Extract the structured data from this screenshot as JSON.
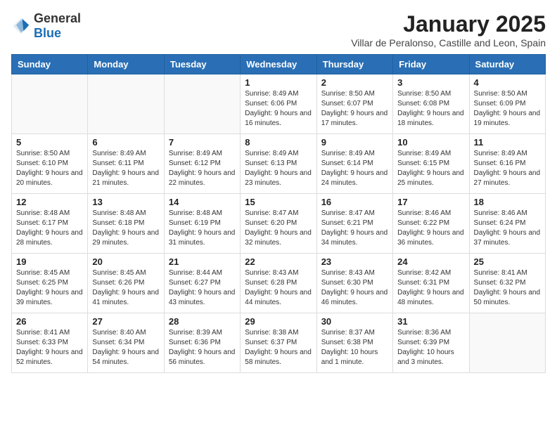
{
  "header": {
    "logo_general": "General",
    "logo_blue": "Blue",
    "month_year": "January 2025",
    "location": "Villar de Peralonso, Castille and Leon, Spain"
  },
  "days_of_week": [
    "Sunday",
    "Monday",
    "Tuesday",
    "Wednesday",
    "Thursday",
    "Friday",
    "Saturday"
  ],
  "weeks": [
    [
      {
        "day": "",
        "info": ""
      },
      {
        "day": "",
        "info": ""
      },
      {
        "day": "",
        "info": ""
      },
      {
        "day": "1",
        "info": "Sunrise: 8:49 AM\nSunset: 6:06 PM\nDaylight: 9 hours and 16 minutes."
      },
      {
        "day": "2",
        "info": "Sunrise: 8:50 AM\nSunset: 6:07 PM\nDaylight: 9 hours and 17 minutes."
      },
      {
        "day": "3",
        "info": "Sunrise: 8:50 AM\nSunset: 6:08 PM\nDaylight: 9 hours and 18 minutes."
      },
      {
        "day": "4",
        "info": "Sunrise: 8:50 AM\nSunset: 6:09 PM\nDaylight: 9 hours and 19 minutes."
      }
    ],
    [
      {
        "day": "5",
        "info": "Sunrise: 8:50 AM\nSunset: 6:10 PM\nDaylight: 9 hours and 20 minutes."
      },
      {
        "day": "6",
        "info": "Sunrise: 8:49 AM\nSunset: 6:11 PM\nDaylight: 9 hours and 21 minutes."
      },
      {
        "day": "7",
        "info": "Sunrise: 8:49 AM\nSunset: 6:12 PM\nDaylight: 9 hours and 22 minutes."
      },
      {
        "day": "8",
        "info": "Sunrise: 8:49 AM\nSunset: 6:13 PM\nDaylight: 9 hours and 23 minutes."
      },
      {
        "day": "9",
        "info": "Sunrise: 8:49 AM\nSunset: 6:14 PM\nDaylight: 9 hours and 24 minutes."
      },
      {
        "day": "10",
        "info": "Sunrise: 8:49 AM\nSunset: 6:15 PM\nDaylight: 9 hours and 25 minutes."
      },
      {
        "day": "11",
        "info": "Sunrise: 8:49 AM\nSunset: 6:16 PM\nDaylight: 9 hours and 27 minutes."
      }
    ],
    [
      {
        "day": "12",
        "info": "Sunrise: 8:48 AM\nSunset: 6:17 PM\nDaylight: 9 hours and 28 minutes."
      },
      {
        "day": "13",
        "info": "Sunrise: 8:48 AM\nSunset: 6:18 PM\nDaylight: 9 hours and 29 minutes."
      },
      {
        "day": "14",
        "info": "Sunrise: 8:48 AM\nSunset: 6:19 PM\nDaylight: 9 hours and 31 minutes."
      },
      {
        "day": "15",
        "info": "Sunrise: 8:47 AM\nSunset: 6:20 PM\nDaylight: 9 hours and 32 minutes."
      },
      {
        "day": "16",
        "info": "Sunrise: 8:47 AM\nSunset: 6:21 PM\nDaylight: 9 hours and 34 minutes."
      },
      {
        "day": "17",
        "info": "Sunrise: 8:46 AM\nSunset: 6:22 PM\nDaylight: 9 hours and 36 minutes."
      },
      {
        "day": "18",
        "info": "Sunrise: 8:46 AM\nSunset: 6:24 PM\nDaylight: 9 hours and 37 minutes."
      }
    ],
    [
      {
        "day": "19",
        "info": "Sunrise: 8:45 AM\nSunset: 6:25 PM\nDaylight: 9 hours and 39 minutes."
      },
      {
        "day": "20",
        "info": "Sunrise: 8:45 AM\nSunset: 6:26 PM\nDaylight: 9 hours and 41 minutes."
      },
      {
        "day": "21",
        "info": "Sunrise: 8:44 AM\nSunset: 6:27 PM\nDaylight: 9 hours and 43 minutes."
      },
      {
        "day": "22",
        "info": "Sunrise: 8:43 AM\nSunset: 6:28 PM\nDaylight: 9 hours and 44 minutes."
      },
      {
        "day": "23",
        "info": "Sunrise: 8:43 AM\nSunset: 6:30 PM\nDaylight: 9 hours and 46 minutes."
      },
      {
        "day": "24",
        "info": "Sunrise: 8:42 AM\nSunset: 6:31 PM\nDaylight: 9 hours and 48 minutes."
      },
      {
        "day": "25",
        "info": "Sunrise: 8:41 AM\nSunset: 6:32 PM\nDaylight: 9 hours and 50 minutes."
      }
    ],
    [
      {
        "day": "26",
        "info": "Sunrise: 8:41 AM\nSunset: 6:33 PM\nDaylight: 9 hours and 52 minutes."
      },
      {
        "day": "27",
        "info": "Sunrise: 8:40 AM\nSunset: 6:34 PM\nDaylight: 9 hours and 54 minutes."
      },
      {
        "day": "28",
        "info": "Sunrise: 8:39 AM\nSunset: 6:36 PM\nDaylight: 9 hours and 56 minutes."
      },
      {
        "day": "29",
        "info": "Sunrise: 8:38 AM\nSunset: 6:37 PM\nDaylight: 9 hours and 58 minutes."
      },
      {
        "day": "30",
        "info": "Sunrise: 8:37 AM\nSunset: 6:38 PM\nDaylight: 10 hours and 1 minute."
      },
      {
        "day": "31",
        "info": "Sunrise: 8:36 AM\nSunset: 6:39 PM\nDaylight: 10 hours and 3 minutes."
      },
      {
        "day": "",
        "info": ""
      }
    ]
  ]
}
